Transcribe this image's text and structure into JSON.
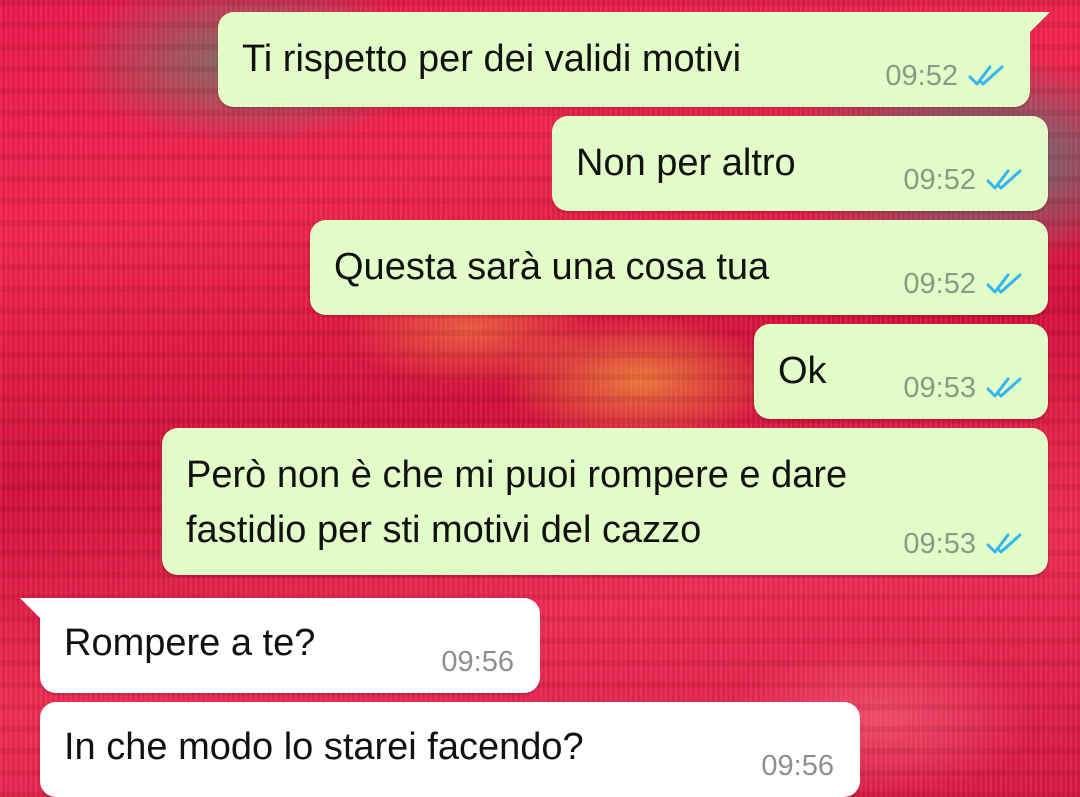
{
  "conversation": {
    "messages": [
      {
        "direction": "out",
        "text": "Ti rispetto per dei validi motivi",
        "time": "09:52",
        "status": "read-double-check-icon"
      },
      {
        "direction": "out",
        "text": "Non per altro",
        "time": "09:52",
        "status": "read-double-check-icon"
      },
      {
        "direction": "out",
        "text": "Questa sarà una cosa tua",
        "time": "09:52",
        "status": "read-double-check-icon"
      },
      {
        "direction": "out",
        "text": "Ok",
        "time": "09:53",
        "status": "read-double-check-icon"
      },
      {
        "direction": "out",
        "text": "Però non è che mi puoi rompere e dare\nfastidio per sti motivi del cazzo",
        "time": "09:53",
        "status": "read-double-check-icon"
      },
      {
        "direction": "in",
        "text": "Rompere a te?",
        "time": "09:56"
      },
      {
        "direction": "in",
        "text": "In che modo lo starei facendo?",
        "time": "09:56"
      }
    ]
  },
  "colors": {
    "outgoing_bubble": "#e2fdc8",
    "incoming_bubble": "#ffffff",
    "read_tick": "#34b7f1",
    "wallpaper_base": "#e81b4f"
  }
}
